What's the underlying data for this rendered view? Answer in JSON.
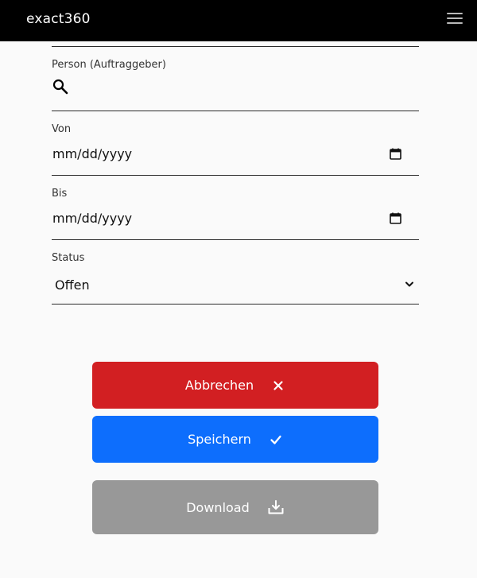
{
  "header": {
    "brand": "exact360",
    "menu_icon": "hamburger-menu-icon"
  },
  "form": {
    "person": {
      "label": "Person (Auftraggeber)",
      "value": "",
      "icon": "search-icon"
    },
    "from": {
      "label": "Von",
      "value": "mm/dd/yyyy",
      "icon": "calendar-icon"
    },
    "to": {
      "label": "Bis",
      "value": "mm/dd/yyyy",
      "icon": "calendar-icon"
    },
    "status": {
      "label": "Status",
      "value": "Offen",
      "icon": "chevron-down-icon"
    }
  },
  "actions": {
    "cancel": {
      "label": "Abbrechen",
      "icon": "close-icon",
      "color": "#d21f22"
    },
    "save": {
      "label": "Speichern",
      "icon": "check-icon",
      "color": "#0d6efd"
    },
    "download": {
      "label": "Download",
      "icon": "download-icon",
      "color": "#989898"
    }
  }
}
